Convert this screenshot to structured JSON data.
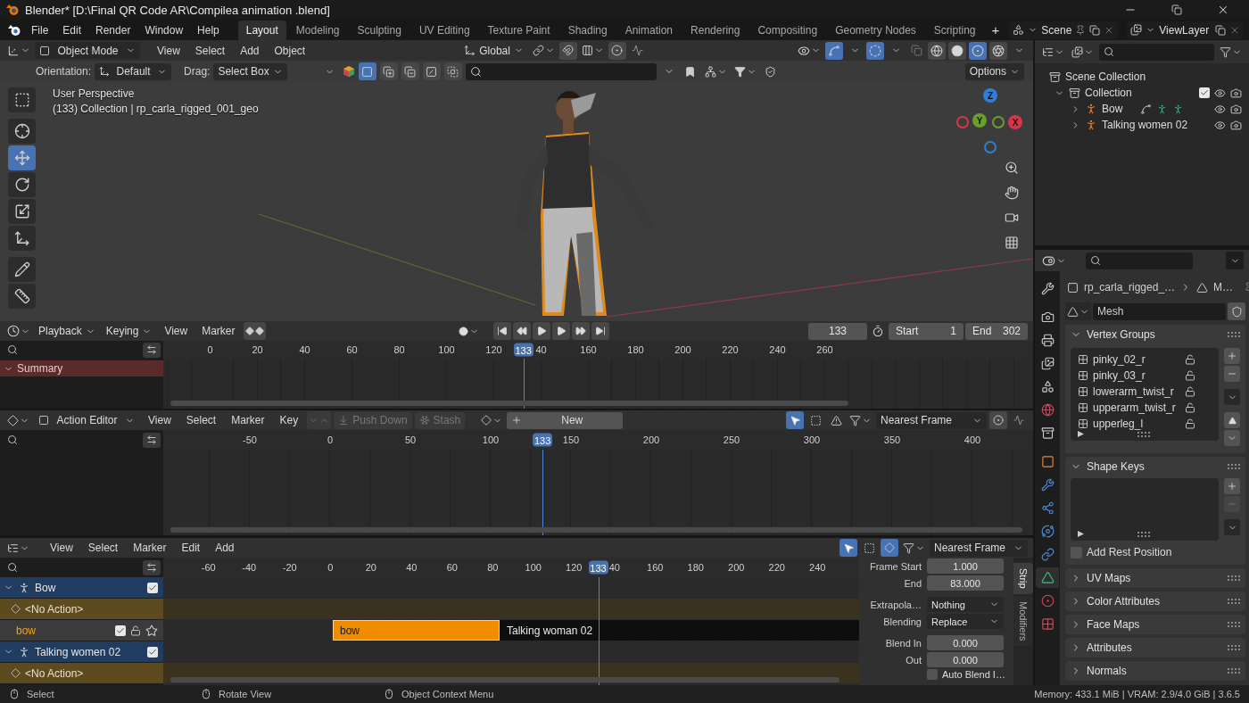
{
  "window": {
    "title": "Blender* [D:\\Final QR Code AR\\Compilea animation .blend]"
  },
  "menu": [
    "File",
    "Edit",
    "Render",
    "Window",
    "Help"
  ],
  "workspaces": [
    {
      "label": "Layout",
      "selected": true
    },
    {
      "label": "Modeling",
      "selected": false
    },
    {
      "label": "Sculpting",
      "selected": false
    },
    {
      "label": "UV Editing",
      "selected": false
    },
    {
      "label": "Texture Paint",
      "selected": false
    },
    {
      "label": "Shading",
      "selected": false
    },
    {
      "label": "Animation",
      "selected": false
    },
    {
      "label": "Rendering",
      "selected": false
    },
    {
      "label": "Compositing",
      "selected": false
    },
    {
      "label": "Geometry Nodes",
      "selected": false
    },
    {
      "label": "Scripting",
      "selected": false
    }
  ],
  "add_workspace": "+",
  "scene": "Scene",
  "view_layer": "ViewLayer",
  "viewport": {
    "mode": "Object Mode",
    "menus": [
      "View",
      "Select",
      "Add",
      "Object"
    ],
    "transform_orientation": "Global",
    "orientation_label": "Orientation:",
    "orientation": "Default",
    "drag_label": "Drag:",
    "drag": "Select Box",
    "options": "Options",
    "select_modes": [
      {
        "kind": "set",
        "selected": true
      },
      {
        "kind": "extend",
        "selected": false
      },
      {
        "kind": "subtract",
        "selected": false
      },
      {
        "kind": "invert",
        "selected": false
      },
      {
        "kind": "intersect",
        "selected": false
      }
    ],
    "shading": [
      {
        "kind": "wireframe",
        "selected": false
      },
      {
        "kind": "solid",
        "selected": false
      },
      {
        "kind": "material",
        "selected": true
      },
      {
        "kind": "rendered",
        "selected": false
      }
    ],
    "gizmo_toggle": {
      "on": true
    },
    "overlay_toggle": {
      "on": true
    },
    "info": [
      "User Perspective",
      "(133) Collection | rp_carla_rigged_001_geo"
    ],
    "tools": [
      {
        "kind": "select",
        "selected": false
      },
      {
        "kind": "cursor",
        "selected": false
      },
      {
        "kind": "move",
        "selected": true
      },
      {
        "kind": "rotate",
        "selected": false
      },
      {
        "kind": "scale",
        "selected": false
      },
      {
        "kind": "transform",
        "selected": false
      },
      {
        "kind": "annotate",
        "selected": false
      },
      {
        "kind": "measure",
        "selected": false
      }
    ],
    "axes": [
      {
        "label": "Z",
        "color": "#2f7fd8"
      },
      {
        "label": "Y",
        "color": "#6a9f2a"
      },
      {
        "label": "X",
        "color": "#d8344a"
      }
    ]
  },
  "outliner": {
    "title": "Scene Collection",
    "collection": {
      "label": "Collection",
      "expanded": true,
      "checked": true
    },
    "objects": [
      {
        "label": "Bow",
        "expanded": false
      },
      {
        "label": "Talking women 02",
        "expanded": false
      }
    ]
  },
  "timeline": {
    "menus": [
      "Playback",
      "Keying",
      "View",
      "Marker"
    ],
    "frame": "133",
    "start_label": "Start",
    "start": "1",
    "end_label": "End",
    "end": "302",
    "ticks": [
      "0",
      "20",
      "40",
      "60",
      "80",
      "100",
      "120",
      "40",
      "160",
      "180",
      "200",
      "220",
      "240",
      "260"
    ],
    "playhead": {
      "label": "133",
      "level": 0.414
    },
    "channels": [
      {
        "label": "Summary",
        "expanded": true
      }
    ]
  },
  "action_editor": {
    "mode": "Action Editor",
    "menus": [
      "View",
      "Select",
      "Marker",
      "Key"
    ],
    "push_down": {
      "label": "Push Down",
      "disabled": true
    },
    "stash": {
      "label": "Stash",
      "disabled": true
    },
    "new": "New",
    "snap": "Nearest Frame",
    "ticks": [
      "-50",
      "0",
      "50",
      "100",
      "150",
      "200",
      "250",
      "300",
      "350",
      "400"
    ],
    "playhead": {
      "label": "133",
      "level": 0.436
    }
  },
  "nla": {
    "menus": [
      "View",
      "Select",
      "Marker",
      "Edit",
      "Add"
    ],
    "snap": "Nearest Frame",
    "ticks": [
      "-60",
      "-40",
      "-20",
      "0",
      "20",
      "40",
      "60",
      "80",
      "100",
      "120",
      "40",
      "160",
      "180",
      "200",
      "220",
      "240"
    ],
    "playhead": {
      "label": "133",
      "level": 0.625
    },
    "tracks": [
      {
        "kind": "object",
        "label": "Bow",
        "checked": true,
        "expanded": true
      },
      {
        "kind": "action",
        "label": "<No Action>"
      },
      {
        "kind": "track",
        "label": "bow",
        "checked": true
      },
      {
        "kind": "object",
        "label": "Talking women 02",
        "checked": true,
        "expanded": true
      },
      {
        "kind": "action",
        "label": "<No Action>"
      }
    ],
    "strips": [
      {
        "label": "bow",
        "selected": true
      },
      {
        "label": "Talking woman 02",
        "selected": false
      }
    ],
    "sidebar": {
      "fields": [
        {
          "label": "Frame Start",
          "value": "1.000",
          "kind": "number"
        },
        {
          "label": "End",
          "value": "83.000",
          "kind": "number"
        },
        {
          "label": "Extrapola…",
          "value": "Nothing",
          "kind": "dropdown"
        },
        {
          "label": "Blending",
          "value": "Replace",
          "kind": "dropdown"
        },
        {
          "label": "Blend In",
          "value": "0.000",
          "kind": "number"
        },
        {
          "label": "Out",
          "value": "0.000",
          "kind": "number"
        }
      ],
      "auto_blend": {
        "label": "Auto Blend I…",
        "checked": false
      },
      "tabs": [
        {
          "label": "Strip",
          "selected": true
        },
        {
          "label": "Modifiers",
          "selected": false
        }
      ]
    }
  },
  "properties": {
    "tabs": [
      {
        "kind": "tool",
        "selected": false
      },
      {
        "kind": "render",
        "selected": false
      },
      {
        "kind": "output",
        "selected": false
      },
      {
        "kind": "view_layer",
        "selected": false
      },
      {
        "kind": "scene",
        "selected": false
      },
      {
        "kind": "world",
        "selected": false
      },
      {
        "kind": "collection",
        "selected": false
      },
      {
        "kind": "object",
        "selected": false
      },
      {
        "kind": "modifiers",
        "selected": false
      },
      {
        "kind": "particles",
        "selected": false
      },
      {
        "kind": "physics",
        "selected": false
      },
      {
        "kind": "constraints",
        "selected": false
      },
      {
        "kind": "data",
        "selected": true
      },
      {
        "kind": "material",
        "selected": false
      },
      {
        "kind": "texture",
        "selected": false
      }
    ],
    "breadcrumb": [
      "rp_carla_rigged_…",
      "M…"
    ],
    "mesh": "Mesh",
    "vertex_groups": {
      "title": "Vertex Groups",
      "expanded": true,
      "items": [
        "pinky_02_r",
        "pinky_03_r",
        "lowerarm_twist_r",
        "upperarm_twist_r",
        "upperleg_l"
      ]
    },
    "shape_keys": {
      "title": "Shape Keys",
      "expanded": true
    },
    "add_rest_position": {
      "label": "Add Rest Position",
      "checked": false
    },
    "panels": [
      {
        "title": "UV Maps",
        "expanded": false
      },
      {
        "title": "Color Attributes",
        "expanded": false
      },
      {
        "title": "Face Maps",
        "expanded": false
      },
      {
        "title": "Attributes",
        "expanded": false
      },
      {
        "title": "Normals",
        "expanded": false
      }
    ]
  },
  "status_bar": {
    "hints": [
      "Select",
      "Rotate View",
      "Object Context Menu"
    ],
    "info": "Memory: 433.1 MiB | VRAM: 2.9/4.0 GiB | 3.6.5"
  }
}
